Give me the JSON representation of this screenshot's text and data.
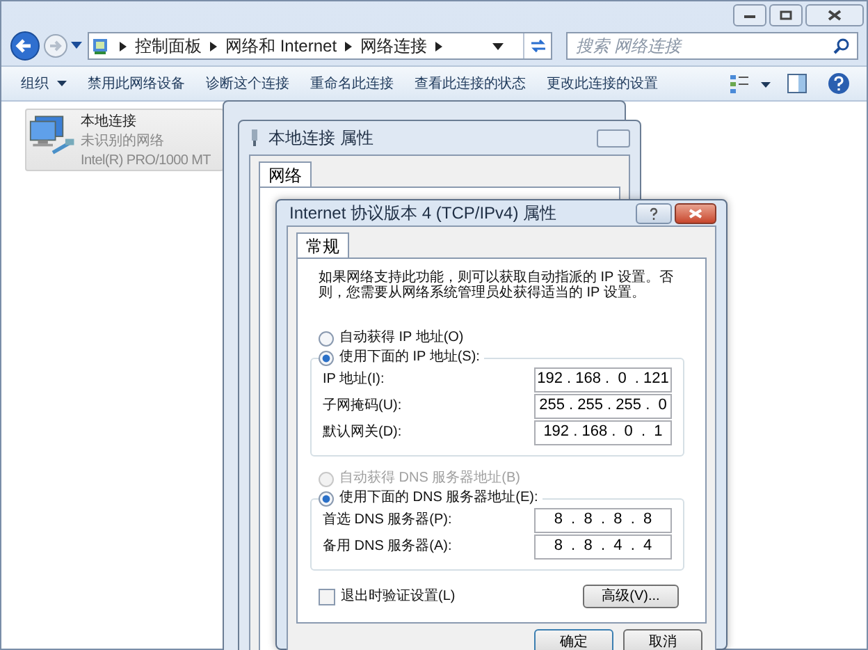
{
  "address_bar": {
    "breadcrumbs": [
      "控制面板",
      "网络和 Internet",
      "网络连接"
    ]
  },
  "search": {
    "placeholder": "搜索 网络连接"
  },
  "toolbar": {
    "items": [
      {
        "label": "组织",
        "kind": "menu"
      },
      {
        "label": "禁用此网络设备",
        "kind": "command"
      },
      {
        "label": "诊断这个连接",
        "kind": "command"
      },
      {
        "label": "重命名此连接",
        "kind": "command"
      },
      {
        "label": "查看此连接的状态",
        "kind": "command"
      },
      {
        "label": "更改此连接的设置",
        "kind": "command"
      }
    ]
  },
  "connection": {
    "name": "本地连接",
    "status": "未识别的网络",
    "adapter": "Intel(R) PRO/1000 MT",
    "selected": true
  },
  "properties_dialog": {
    "title": "本地连接 属性",
    "tabs": [
      {
        "label": "网络",
        "selected": true
      }
    ]
  },
  "ipv4_dialog": {
    "title": "Internet 协议版本 4 (TCP/IPv4) 属性",
    "tabs": [
      {
        "label": "常规",
        "selected": true
      }
    ],
    "description": "如果网络支持此功能，则可以获取自动指派的 IP 设置。否则，您需要从网络系统管理员处获得适当的 IP 设置。",
    "ip_options": [
      {
        "label": "自动获得 IP 地址(O)",
        "selected": false,
        "disabled": false
      },
      {
        "label": "使用下面的 IP 地址(S):",
        "selected": true,
        "disabled": false
      }
    ],
    "ip_fields": [
      {
        "label": "IP 地址(I):",
        "value": "192 . 168 .  0  . 121"
      },
      {
        "label": "子网掩码(U):",
        "value": "255 . 255 . 255 .  0"
      },
      {
        "label": "默认网关(D):",
        "value": "192 . 168 .  0  .  1"
      }
    ],
    "dns_options": [
      {
        "label": "自动获得 DNS 服务器地址(B)",
        "selected": false,
        "disabled": true
      },
      {
        "label": "使用下面的 DNS 服务器地址(E):",
        "selected": true,
        "disabled": false
      }
    ],
    "dns_fields": [
      {
        "label": "首选 DNS 服务器(P):",
        "value": "8  .  8  .  8  .  8"
      },
      {
        "label": "备用 DNS 服务器(A):",
        "value": "8  .  8  .  4  .  4"
      }
    ],
    "validate_on_exit": {
      "label": "退出时验证设置(L)",
      "checked": false
    },
    "advanced_button": "高级(V)...",
    "buttons": [
      "确定",
      "取消"
    ]
  }
}
